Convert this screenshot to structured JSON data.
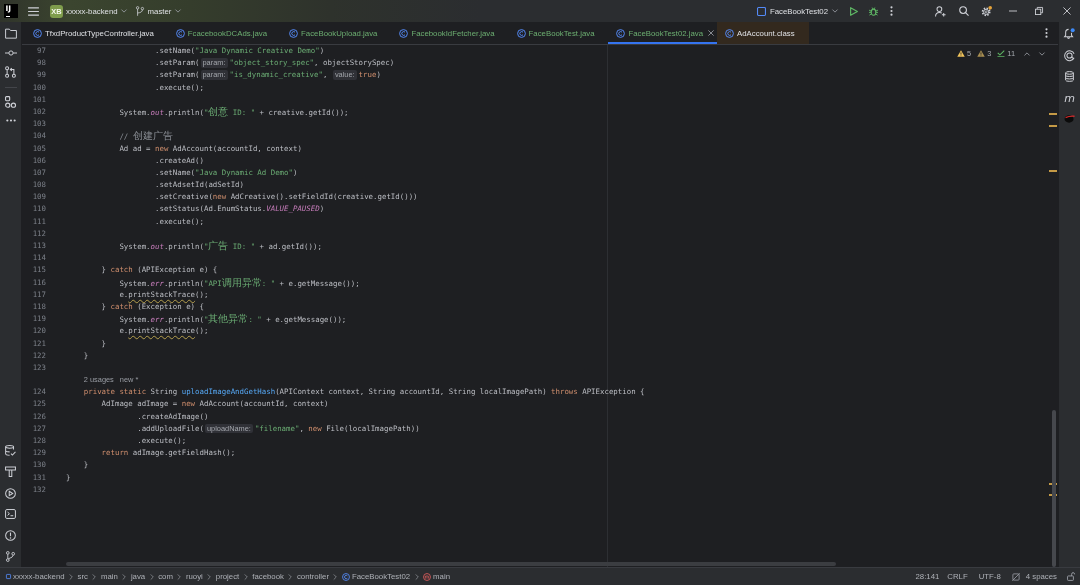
{
  "title_bar": {
    "logo": "IJ",
    "project_badge": "XB",
    "project": "xxxxx-backend",
    "branch": "master",
    "run_config": "FaceBookTest02",
    "settings_badge": true
  },
  "tabs": [
    {
      "label": "TfxdProductTypeController.java",
      "kind": "source",
      "added": false,
      "selected": false
    },
    {
      "label": "FcacebookDCAds.java",
      "kind": "source",
      "added": true,
      "selected": false
    },
    {
      "label": "FaceBookUpload.java",
      "kind": "source",
      "added": true,
      "selected": false
    },
    {
      "label": "FacebookIdFetcher.java",
      "kind": "source",
      "added": true,
      "selected": false
    },
    {
      "label": "FaceBookTest.java",
      "kind": "source",
      "added": true,
      "selected": false
    },
    {
      "label": "FaceBookTest02.java",
      "kind": "source",
      "added": true,
      "selected": true
    },
    {
      "label": "AdAccount.class",
      "kind": "library",
      "added": false,
      "selected": false
    }
  ],
  "inspections": [
    {
      "kind": "warning",
      "count": "5"
    },
    {
      "kind": "weak_warning",
      "count": "3"
    },
    {
      "kind": "typo",
      "count": "11"
    }
  ],
  "right_toolbar": {
    "notifications_unread": true,
    "maven_glyph": "m"
  },
  "editor": {
    "lines": [
      {
        "kind": "code",
        "number": "97",
        "segments": [
          {
            "kind": "plain",
            "text": "                    .setName("
          },
          {
            "kind": "string",
            "text": "\"Java Dynamic Creative Demo\""
          },
          {
            "kind": "plain",
            "text": ")"
          }
        ]
      },
      {
        "kind": "code",
        "number": "98",
        "segments": [
          {
            "kind": "plain",
            "text": "                    .setParam("
          },
          {
            "kind": "hint",
            "text": "param:"
          },
          {
            "kind": "string",
            "text": "\"object_story_spec\""
          },
          {
            "kind": "plain",
            "text": ", objectStorySpec)"
          }
        ]
      },
      {
        "kind": "code",
        "number": "99",
        "segments": [
          {
            "kind": "plain",
            "text": "                    .setParam("
          },
          {
            "kind": "hint",
            "text": "param:"
          },
          {
            "kind": "string",
            "text": "\"is_dynamic_creative\""
          },
          {
            "kind": "plain",
            "text": ", "
          },
          {
            "kind": "hint",
            "text": "value:"
          },
          {
            "kind": "keyword",
            "text": "true"
          },
          {
            "kind": "plain",
            "text": ")"
          }
        ]
      },
      {
        "kind": "code",
        "number": "100",
        "segments": [
          {
            "kind": "plain",
            "text": "                    .execute();"
          }
        ]
      },
      {
        "kind": "code",
        "number": "101"
      },
      {
        "kind": "code",
        "number": "102",
        "segments": [
          {
            "kind": "plain",
            "text": "            System."
          },
          {
            "kind": "static",
            "text": "out"
          },
          {
            "kind": "plain",
            "text": ".println("
          },
          {
            "kind": "string",
            "text": "\"创意 ID: \""
          },
          {
            "kind": "plain",
            "text": " + creative.getId());"
          }
        ]
      },
      {
        "kind": "code",
        "number": "103"
      },
      {
        "kind": "code",
        "number": "104",
        "segments": [
          {
            "kind": "comment",
            "text": "            // 创建广告"
          }
        ]
      },
      {
        "kind": "code",
        "number": "105",
        "segments": [
          {
            "kind": "plain",
            "text": "            Ad ad = "
          },
          {
            "kind": "keyword",
            "text": "new"
          },
          {
            "kind": "plain",
            "text": " AdAccount(accountId, context)"
          }
        ]
      },
      {
        "kind": "code",
        "number": "106",
        "segments": [
          {
            "kind": "plain",
            "text": "                    .createAd()"
          }
        ]
      },
      {
        "kind": "code",
        "number": "107",
        "segments": [
          {
            "kind": "plain",
            "text": "                    .setName("
          },
          {
            "kind": "string",
            "text": "\"Java Dynamic Ad Demo\""
          },
          {
            "kind": "plain",
            "text": ")"
          }
        ]
      },
      {
        "kind": "code",
        "number": "108",
        "segments": [
          {
            "kind": "plain",
            "text": "                    .setAdsetId(adSetId)"
          }
        ]
      },
      {
        "kind": "code",
        "number": "109",
        "segments": [
          {
            "kind": "plain",
            "text": "                    .setCreative("
          },
          {
            "kind": "keyword",
            "text": "new"
          },
          {
            "kind": "plain",
            "text": " AdCreative().setFieldId(creative.getId()))"
          }
        ]
      },
      {
        "kind": "code",
        "number": "110",
        "segments": [
          {
            "kind": "plain",
            "text": "                    .setStatus(Ad.EnumStatus."
          },
          {
            "kind": "static",
            "text": "VALUE_PAUSED"
          },
          {
            "kind": "plain",
            "text": ")"
          }
        ]
      },
      {
        "kind": "code",
        "number": "111",
        "segments": [
          {
            "kind": "plain",
            "text": "                    .execute();"
          }
        ]
      },
      {
        "kind": "code",
        "number": "112"
      },
      {
        "kind": "code",
        "number": "113",
        "segments": [
          {
            "kind": "plain",
            "text": "            System."
          },
          {
            "kind": "static",
            "text": "out"
          },
          {
            "kind": "plain",
            "text": ".println("
          },
          {
            "kind": "string",
            "text": "\"广告 ID: \""
          },
          {
            "kind": "plain",
            "text": " + ad.getId());"
          }
        ]
      },
      {
        "kind": "code",
        "number": "114"
      },
      {
        "kind": "code",
        "number": "115",
        "segments": [
          {
            "kind": "plain",
            "text": "        } "
          },
          {
            "kind": "keyword",
            "text": "catch"
          },
          {
            "kind": "plain",
            "text": " (APIException e) {"
          }
        ]
      },
      {
        "kind": "code",
        "number": "116",
        "segments": [
          {
            "kind": "plain",
            "text": "            System."
          },
          {
            "kind": "static",
            "text": "err"
          },
          {
            "kind": "plain",
            "text": ".println("
          },
          {
            "kind": "string",
            "text": "\"API调用异常: \""
          },
          {
            "kind": "plain",
            "text": " + e.getMessage());"
          }
        ]
      },
      {
        "kind": "code",
        "number": "117",
        "segments": [
          {
            "kind": "plain",
            "text": "            e."
          },
          {
            "kind": "warning",
            "text": "printStackTrace"
          },
          {
            "kind": "plain",
            "text": "();"
          }
        ]
      },
      {
        "kind": "code",
        "number": "118",
        "segments": [
          {
            "kind": "plain",
            "text": "        } "
          },
          {
            "kind": "keyword",
            "text": "catch"
          },
          {
            "kind": "plain",
            "text": " (Exception e) {"
          }
        ]
      },
      {
        "kind": "code",
        "number": "119",
        "segments": [
          {
            "kind": "plain",
            "text": "            System."
          },
          {
            "kind": "static",
            "text": "err"
          },
          {
            "kind": "plain",
            "text": ".println("
          },
          {
            "kind": "string",
            "text": "\"其他异常: \""
          },
          {
            "kind": "plain",
            "text": " + e.getMessage());"
          }
        ]
      },
      {
        "kind": "code",
        "number": "120",
        "segments": [
          {
            "kind": "plain",
            "text": "            e."
          },
          {
            "kind": "warning",
            "text": "printStackTrace"
          },
          {
            "kind": "plain",
            "text": "();"
          }
        ]
      },
      {
        "kind": "code",
        "number": "121",
        "segments": [
          {
            "kind": "plain",
            "text": "        }"
          }
        ]
      },
      {
        "kind": "code",
        "number": "122",
        "segments": [
          {
            "kind": "plain",
            "text": "    }"
          }
        ]
      },
      {
        "kind": "code",
        "number": "123"
      },
      {
        "kind": "vision",
        "segments": [
          {
            "kind": "usages",
            "text": "    2 usages"
          },
          {
            "kind": "author",
            "text": "new *"
          }
        ]
      },
      {
        "kind": "code",
        "number": "124",
        "segments": [
          {
            "kind": "keyword",
            "text": "    private static"
          },
          {
            "kind": "plain",
            "text": " String "
          },
          {
            "kind": "method",
            "text": "uploadImageAndGetHash"
          },
          {
            "kind": "plain",
            "text": "(APIContext context, String accountId, String localImagePath) "
          },
          {
            "kind": "keyword",
            "text": "throws"
          },
          {
            "kind": "plain",
            "text": " APIException {"
          }
        ]
      },
      {
        "kind": "code",
        "number": "125",
        "segments": [
          {
            "kind": "plain",
            "text": "        AdImage adImage = "
          },
          {
            "kind": "keyword",
            "text": "new"
          },
          {
            "kind": "plain",
            "text": " AdAccount(accountId, context)"
          }
        ]
      },
      {
        "kind": "code",
        "number": "126",
        "segments": [
          {
            "kind": "plain",
            "text": "                .createAdImage()"
          }
        ]
      },
      {
        "kind": "code",
        "number": "127",
        "segments": [
          {
            "kind": "plain",
            "text": "                .addUploadFile("
          },
          {
            "kind": "hint",
            "text": "uploadName:"
          },
          {
            "kind": "string",
            "text": "\"filename\""
          },
          {
            "kind": "plain",
            "text": ", "
          },
          {
            "kind": "keyword",
            "text": "new"
          },
          {
            "kind": "plain",
            "text": " File(localImagePath))"
          }
        ]
      },
      {
        "kind": "code",
        "number": "128",
        "segments": [
          {
            "kind": "plain",
            "text": "                .execute();"
          }
        ]
      },
      {
        "kind": "code",
        "number": "129",
        "segments": [
          {
            "kind": "keyword",
            "text": "        return"
          },
          {
            "kind": "plain",
            "text": " adImage.getFieldHash();"
          }
        ]
      },
      {
        "kind": "code",
        "number": "130",
        "segments": [
          {
            "kind": "plain",
            "text": "    }"
          }
        ]
      },
      {
        "kind": "code",
        "number": "131",
        "segments": [
          {
            "kind": "plain",
            "text": "}"
          }
        ]
      },
      {
        "kind": "code",
        "number": "132"
      }
    ]
  },
  "breadcrumbs": [
    {
      "kind": "module",
      "label": "xxxxx-backend"
    },
    {
      "kind": "folder",
      "label": "src"
    },
    {
      "kind": "folder",
      "label": "main"
    },
    {
      "kind": "folder",
      "label": "java"
    },
    {
      "kind": "folder",
      "label": "com"
    },
    {
      "kind": "folder",
      "label": "ruoyi"
    },
    {
      "kind": "folder",
      "label": "project"
    },
    {
      "kind": "folder",
      "label": "facebook"
    },
    {
      "kind": "folder",
      "label": "controller"
    },
    {
      "kind": "class",
      "label": "FaceBookTest02"
    },
    {
      "kind": "method",
      "label": "main"
    }
  ],
  "status_bar": {
    "position": "28:141",
    "line_separator": "CRLF",
    "encoding": "UTF-8",
    "indent": "4 spaces"
  }
}
